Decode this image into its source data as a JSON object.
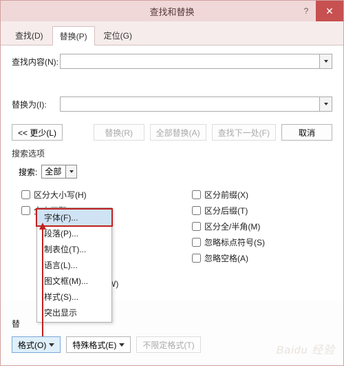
{
  "window": {
    "title": "查找和替换",
    "help": "?",
    "close": "✕"
  },
  "tabs": {
    "find": "查找(D)",
    "replace": "替换(P)",
    "goto": "定位(G)"
  },
  "fields": {
    "find_label": "查找内容(N):",
    "replace_label": "替换为(I):"
  },
  "buttons": {
    "less": "<< 更少(L)",
    "replace": "替换(R)",
    "replace_all": "全部替换(A)",
    "find_next": "查找下一处(F)",
    "cancel": "取消"
  },
  "search_options": {
    "title": "搜索选项",
    "search_label": "搜索:",
    "search_value": "全部",
    "left": {
      "match_case": "区分大小写(H)",
      "whole_word": "全字匹配(Y)",
      "wildcards_partial": "文)(W)"
    },
    "right": {
      "prefix": "区分前缀(X)",
      "suffix": "区分后缀(T)",
      "fullhalf": "区分全/半角(M)",
      "punct": "忽略标点符号(S)",
      "space": "忽略空格(A)"
    }
  },
  "format_menu": {
    "font": "字体(F)...",
    "paragraph": "段落(P)...",
    "tabs": "制表位(T)...",
    "language": "语言(L)...",
    "frame": "图文框(M)...",
    "style": "样式(S)...",
    "highlight": "突出显示"
  },
  "bottom": {
    "replace_section": "替",
    "format": "格式(O)",
    "special": "特殊格式(E)",
    "noformat": "不限定格式(T)"
  },
  "watermark": "Baidu 经验"
}
